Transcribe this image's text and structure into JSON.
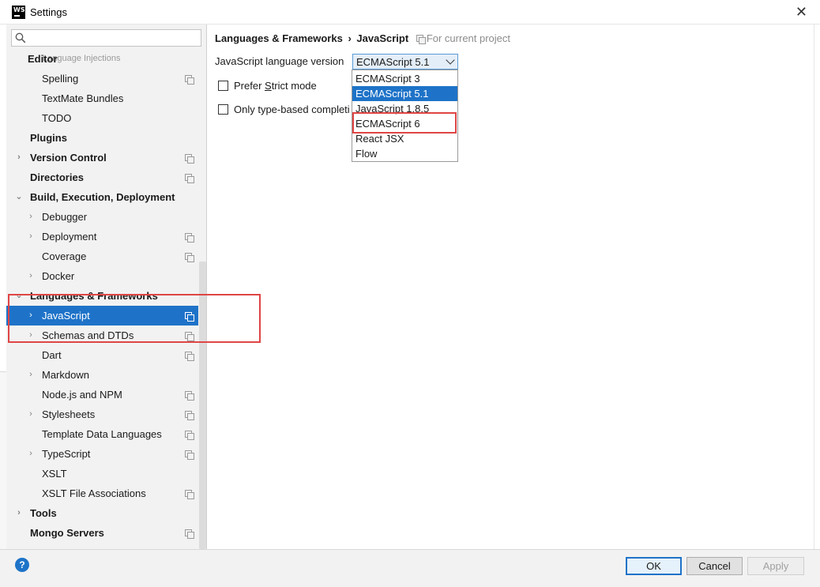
{
  "window": {
    "title": "Settings",
    "app_icon_text": "WS",
    "close_glyph": "✕"
  },
  "search": {
    "placeholder": "",
    "value": ""
  },
  "sidebar": {
    "partial_label": "Language Injections",
    "items": [
      {
        "label": "Editor",
        "bold": true,
        "arrow": "",
        "icon": false
      },
      {
        "label": "Spelling",
        "bold": false,
        "arrow": "",
        "icon": true
      },
      {
        "label": "TextMate Bundles",
        "bold": false,
        "arrow": "",
        "icon": false
      },
      {
        "label": "TODO",
        "bold": false,
        "arrow": "",
        "icon": false
      },
      {
        "label": "Plugins",
        "bold": true,
        "arrow": "",
        "icon": false
      },
      {
        "label": "Version Control",
        "bold": true,
        "arrow": "›",
        "icon": true
      },
      {
        "label": "Directories",
        "bold": true,
        "arrow": "",
        "icon": true
      },
      {
        "label": "Build, Execution, Deployment",
        "bold": true,
        "arrow": "⌄",
        "icon": false
      },
      {
        "label": "Debugger",
        "bold": false,
        "arrow": "›",
        "icon": false
      },
      {
        "label": "Deployment",
        "bold": false,
        "arrow": "›",
        "icon": true
      },
      {
        "label": "Coverage",
        "bold": false,
        "arrow": "",
        "icon": true
      },
      {
        "label": "Docker",
        "bold": false,
        "arrow": "›",
        "icon": false
      },
      {
        "label": "Languages & Frameworks",
        "bold": true,
        "arrow": "⌄",
        "icon": false
      },
      {
        "label": "JavaScript",
        "bold": false,
        "arrow": "›",
        "icon": true,
        "selected": true
      },
      {
        "label": "Schemas and DTDs",
        "bold": false,
        "arrow": "›",
        "icon": true
      },
      {
        "label": "Dart",
        "bold": false,
        "arrow": "",
        "icon": true
      },
      {
        "label": "Markdown",
        "bold": false,
        "arrow": "›",
        "icon": false
      },
      {
        "label": "Node.js and NPM",
        "bold": false,
        "arrow": "",
        "icon": true
      },
      {
        "label": "Stylesheets",
        "bold": false,
        "arrow": "›",
        "icon": true
      },
      {
        "label": "Template Data Languages",
        "bold": false,
        "arrow": "",
        "icon": true
      },
      {
        "label": "TypeScript",
        "bold": false,
        "arrow": "›",
        "icon": true
      },
      {
        "label": "XSLT",
        "bold": false,
        "arrow": "",
        "icon": false
      },
      {
        "label": "XSLT File Associations",
        "bold": false,
        "arrow": "",
        "icon": true
      },
      {
        "label": "Tools",
        "bold": true,
        "arrow": "›",
        "icon": false
      },
      {
        "label": "Mongo Servers",
        "bold": true,
        "arrow": "",
        "icon": true
      }
    ]
  },
  "main": {
    "breadcrumb": {
      "parent": "Languages & Frameworks",
      "separator": "›",
      "current": "JavaScript",
      "scope": "For current project"
    },
    "version_label": "JavaScript language version",
    "selected_version": "ECMAScript 5.1",
    "options": [
      "ECMAScript 3",
      "ECMAScript 5.1",
      "JavaScript 1.8.5",
      "ECMAScript 6",
      "React JSX",
      "Flow"
    ],
    "prefer_strict": {
      "before": "Prefer ",
      "mnemonic": "S",
      "after": "trict mode",
      "checked": false
    },
    "type_based": {
      "label": "Only type-based completion",
      "visible_label": "Only type-based completi",
      "checked": false
    }
  },
  "footer": {
    "help": "?",
    "ok": "OK",
    "cancel": "Cancel",
    "apply": "Apply"
  },
  "colors": {
    "selection": "#1e73c8",
    "annotation": "#e04545",
    "sidebar_bg": "#f2f2f2"
  }
}
